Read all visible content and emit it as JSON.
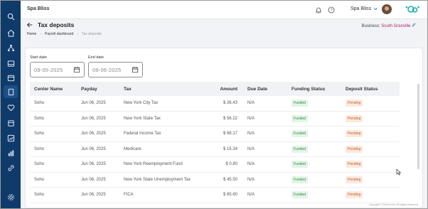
{
  "topbar": {
    "app_name": "Spa Bliss",
    "company_selector": "Spa Bliss",
    "icons": [
      "bell-icon",
      "help-icon",
      "chevron-down-icon"
    ]
  },
  "sidebar": {
    "icons": [
      "search-icon",
      "home-icon",
      "network-icon",
      "inbox-icon",
      "calendar-icon",
      "document-icon",
      "heart-icon",
      "box-icon",
      "chart-icon",
      "bar-chart-icon",
      "link-icon",
      "settings-icon"
    ]
  },
  "header": {
    "title": "Tax deposits",
    "breadcrumb": [
      "Home",
      "Payroll dashboard",
      "Tax deposits"
    ],
    "business_label": "Business:",
    "business_value": "South Granville"
  },
  "filters": {
    "start_date_label": "Start date",
    "start_date_value": "09-05-2025",
    "end_date_label": "End date",
    "end_date_value": "09-06-2025"
  },
  "table": {
    "columns": [
      "Center Name",
      "Payday",
      "Tax",
      "Amount",
      "Due Date",
      "Funding Status",
      "Deposit Status"
    ],
    "rows": [
      {
        "center": "Soho",
        "payday": "Jun 06, 2025",
        "tax": "New York City Tax",
        "amount": "$ 26.43",
        "due": "N/A",
        "funding": "Funded",
        "deposit": "Pending"
      },
      {
        "center": "Soho",
        "payday": "Jun 06, 2025",
        "tax": "New York State Tax",
        "amount": "$ 56.22",
        "due": "N/A",
        "funding": "Funded",
        "deposit": "Pending"
      },
      {
        "center": "Soho",
        "payday": "Jun 06, 2025",
        "tax": "Federal Income Tax",
        "amount": "$ 68.17",
        "due": "N/A",
        "funding": "Funded",
        "deposit": "Pending"
      },
      {
        "center": "Soho",
        "payday": "Jun 06, 2025",
        "tax": "Medicare",
        "amount": "$ 15.34",
        "due": "N/A",
        "funding": "Funded",
        "deposit": "Pending"
      },
      {
        "center": "Soho",
        "payday": "Jun 06, 2025",
        "tax": "New York Reemployment Fund",
        "amount": "$ 0.80",
        "due": "N/A",
        "funding": "Funded",
        "deposit": "Pending"
      },
      {
        "center": "Soho",
        "payday": "Jun 06, 2025",
        "tax": "New York State Unemployment Tax",
        "amount": "$ 45.50",
        "due": "N/A",
        "funding": "Funded",
        "deposit": "Pending"
      },
      {
        "center": "Soho",
        "payday": "Jun 06, 2025",
        "tax": "FICA",
        "amount": "$ 65.60",
        "due": "N/A",
        "funding": "Funded",
        "deposit": "Pending"
      }
    ]
  },
  "footer": {
    "copyright": "Copyright © Zenoti.com. All Rights Reserved."
  },
  "colors": {
    "sidebar": "#0f3b6b",
    "business_accent": "#b02a5b",
    "funded_text": "#2e8b46",
    "pending_text": "#c25f2a"
  }
}
